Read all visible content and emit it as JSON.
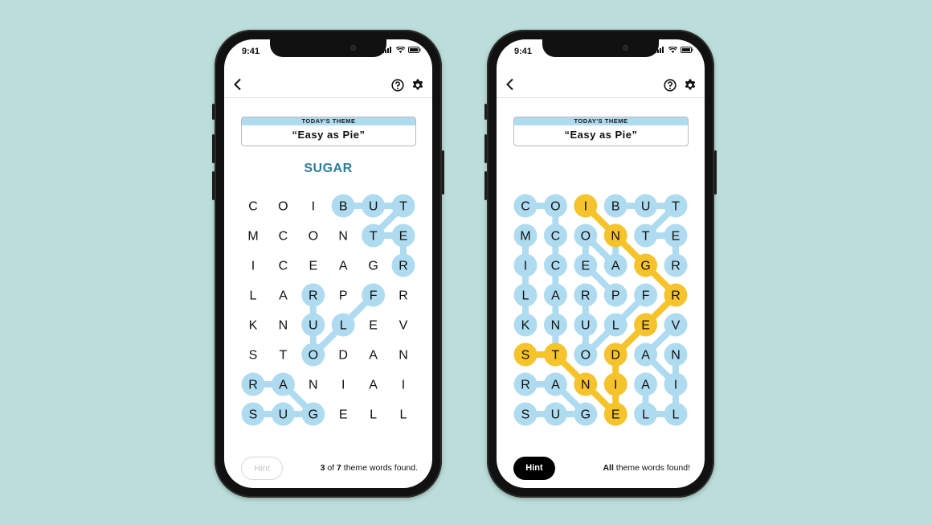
{
  "colors": {
    "background": "#bcdeda",
    "found_blue": "#aedbef",
    "spangram_yellow": "#f5c32c",
    "found_word_text": "#2a7f9f"
  },
  "grid_letters": [
    [
      "C",
      "O",
      "I",
      "B",
      "U",
      "T"
    ],
    [
      "M",
      "C",
      "O",
      "N",
      "T",
      "E"
    ],
    [
      "I",
      "C",
      "E",
      "A",
      "G",
      "R"
    ],
    [
      "L",
      "A",
      "R",
      "P",
      "F",
      "R"
    ],
    [
      "K",
      "N",
      "U",
      "L",
      "E",
      "V"
    ],
    [
      "S",
      "T",
      "O",
      "D",
      "A",
      "N"
    ],
    [
      "R",
      "A",
      "N",
      "I",
      "A",
      "I"
    ],
    [
      "S",
      "U",
      "G",
      "E",
      "L",
      "L"
    ]
  ],
  "phones": [
    {
      "status_time": "9:41",
      "theme_label": "TODAY'S THEME",
      "theme_title": "“Easy as Pie”",
      "current_word": "SUGAR",
      "hint_label": "Hint",
      "hint_state": "disabled",
      "status_found": "3",
      "status_of": "of",
      "status_total": "7",
      "status_suffix": "theme words found.",
      "found_words": [
        {
          "word": "BUTTER",
          "color": "blue",
          "cells": [
            [
              0,
              3
            ],
            [
              0,
              4
            ],
            [
              0,
              5
            ],
            [
              1,
              4
            ],
            [
              1,
              5
            ],
            [
              2,
              5
            ]
          ]
        },
        {
          "word": "FLOUR",
          "color": "blue",
          "cells": [
            [
              3,
              4
            ],
            [
              4,
              3
            ],
            [
              5,
              2
            ],
            [
              4,
              2
            ],
            [
              3,
              2
            ]
          ]
        },
        {
          "word": "SUGAR",
          "color": "blue",
          "cells": [
            [
              7,
              0
            ],
            [
              7,
              1
            ],
            [
              7,
              2
            ],
            [
              6,
              1
            ],
            [
              6,
              0
            ]
          ]
        }
      ]
    },
    {
      "status_time": "9:41",
      "theme_label": "TODAY'S THEME",
      "theme_title": "“Easy as Pie”",
      "current_word": "",
      "hint_label": "Hint",
      "hint_state": "active",
      "status_lead": "All",
      "status_suffix": "theme words found!",
      "found_words": [
        {
          "word": "COCONUT",
          "color": "blue",
          "cells": [
            [
              0,
              0
            ],
            [
              0,
              1
            ],
            [
              1,
              1
            ],
            [
              2,
              1
            ],
            [
              3,
              1
            ],
            [
              4,
              1
            ],
            [
              5,
              1
            ]
          ]
        },
        {
          "word": "MILK",
          "color": "blue",
          "cells": [
            [
              1,
              0
            ],
            [
              2,
              0
            ],
            [
              3,
              0
            ],
            [
              4,
              0
            ]
          ]
        },
        {
          "word": "BUTTER",
          "color": "blue",
          "cells": [
            [
              0,
              3
            ],
            [
              0,
              4
            ],
            [
              0,
              5
            ],
            [
              1,
              4
            ],
            [
              1,
              5
            ],
            [
              2,
              5
            ]
          ]
        },
        {
          "word": "FLOUR",
          "color": "blue",
          "cells": [
            [
              3,
              4
            ],
            [
              4,
              3
            ],
            [
              5,
              2
            ],
            [
              4,
              2
            ],
            [
              3,
              2
            ]
          ]
        },
        {
          "word": "PECAN",
          "color": "blue",
          "cells": [
            [
              3,
              3
            ],
            [
              2,
              2
            ],
            [
              1,
              2
            ],
            [
              2,
              3
            ],
            [
              1,
              3
            ]
          ]
        },
        {
          "word": "SUGAR",
          "color": "blue",
          "cells": [
            [
              7,
              0
            ],
            [
              7,
              1
            ],
            [
              7,
              2
            ],
            [
              6,
              1
            ],
            [
              6,
              0
            ]
          ]
        },
        {
          "word": "VANILLA",
          "color": "blue",
          "cells": [
            [
              4,
              5
            ],
            [
              5,
              4
            ],
            [
              6,
              5
            ],
            [
              5,
              5
            ],
            [
              7,
              5
            ],
            [
              7,
              4
            ],
            [
              6,
              4
            ]
          ]
        },
        {
          "word": "INGREDIENTS",
          "color": "yellow",
          "cells": [
            [
              0,
              2
            ],
            [
              1,
              3
            ],
            [
              2,
              4
            ],
            [
              3,
              5
            ],
            [
              4,
              4
            ],
            [
              5,
              3
            ],
            [
              6,
              3
            ],
            [
              7,
              3
            ],
            [
              6,
              2
            ],
            [
              5,
              1
            ],
            [
              5,
              0
            ]
          ]
        }
      ]
    }
  ]
}
